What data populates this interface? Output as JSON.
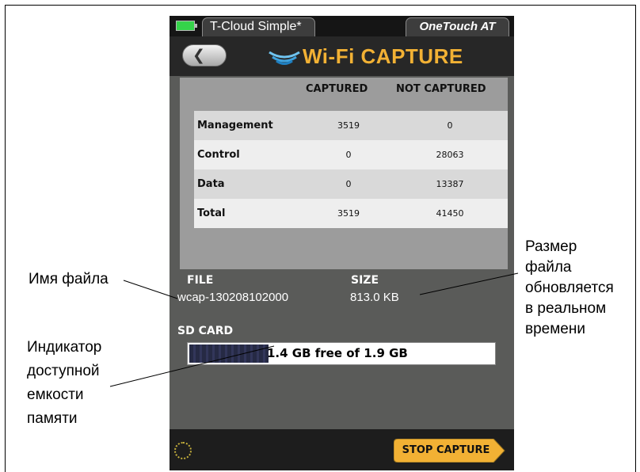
{
  "status_bar": {
    "profile": "T-Cloud Simple*",
    "brand": "OneTouch AT"
  },
  "header": {
    "back_icon": "chevron-left-icon",
    "wifi_icon": "wifi-waves-icon",
    "title": "Wi-Fi CAPTURE"
  },
  "stats": {
    "columns": [
      "CAPTURED",
      "NOT CAPTURED"
    ],
    "rows": [
      {
        "name": "Management",
        "captured": "3519",
        "not_captured": "0"
      },
      {
        "name": "Control",
        "captured": "0",
        "not_captured": "28063"
      },
      {
        "name": "Data",
        "captured": "0",
        "not_captured": "13387"
      },
      {
        "name": "Total",
        "captured": "3519",
        "not_captured": "41450"
      }
    ]
  },
  "file": {
    "label": "FILE",
    "name": "wcap-130208102000"
  },
  "size": {
    "label": "SIZE",
    "value": "813.0 KB"
  },
  "sd_card": {
    "label": "SD CARD",
    "text": "1.4 GB free of 1.9 GB",
    "used_fraction": 0.26
  },
  "bottom": {
    "spinner_icon": "loading-spinner-icon",
    "stop_label": "STOP CAPTURE"
  },
  "annotations": {
    "file_name": "Имя файла",
    "size_lines": [
      "Размер",
      "файла",
      "обновляется",
      "в реальном",
      "времени"
    ],
    "sd_lines": [
      "Индикатор",
      "доступной",
      "емкости",
      "памяти"
    ]
  },
  "colors": {
    "title": "#f2b134",
    "stop_button": "#f2b134",
    "battery": "#35d34a"
  }
}
